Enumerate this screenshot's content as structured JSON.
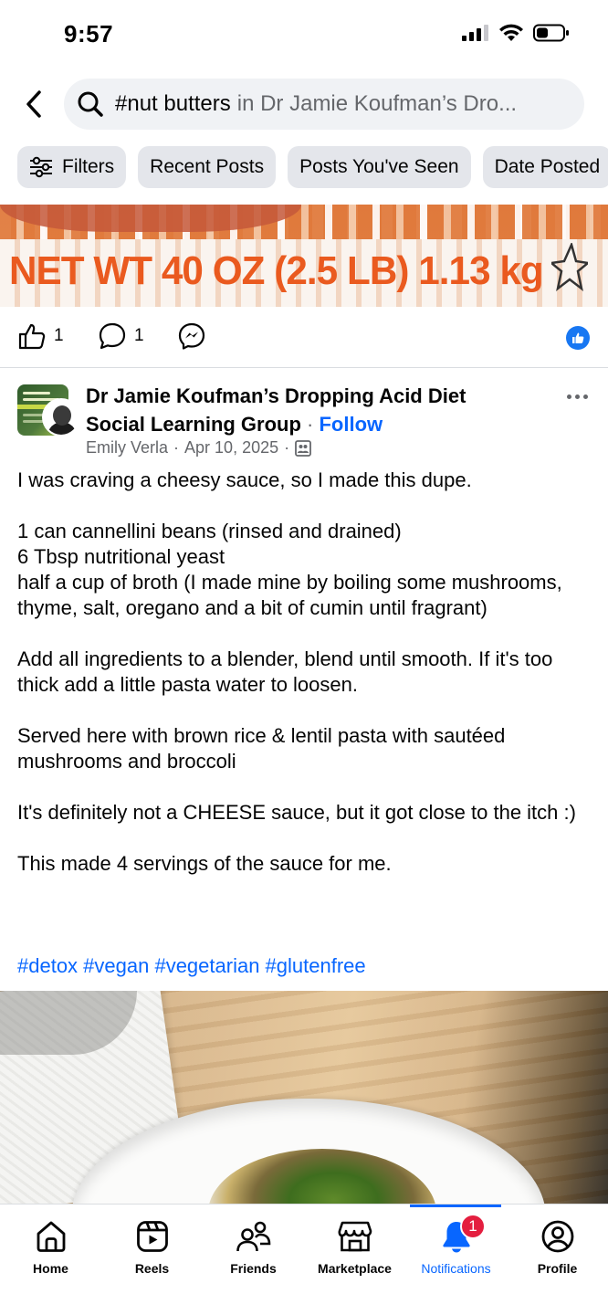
{
  "status_bar": {
    "time": "9:57"
  },
  "search": {
    "query": "#nut butters",
    "scope": "in Dr Jamie Koufman’s  Dro..."
  },
  "filters": [
    {
      "label": "Filters",
      "icon": "sliders-icon"
    },
    {
      "label": "Recent Posts"
    },
    {
      "label": "Posts You've Seen"
    },
    {
      "label": "Date Posted"
    }
  ],
  "previous_post": {
    "image_text": "NET WT 40 OZ (2.5 LB) 1.13 kg",
    "like_count": "1",
    "comment_count": "1"
  },
  "post": {
    "group_name": "Dr Jamie Koufman’s  Dropping Acid Diet Social Learning Group",
    "follow_label": "Follow",
    "author": "Emily Verla",
    "date": "Apr 10, 2025",
    "body": [
      "I was craving a cheesy sauce, so I made this dupe.",
      "",
      "1 can cannellini beans (rinsed and drained)",
      "6 Tbsp nutritional yeast",
      "half a cup of broth (I made mine by boiling some mushrooms, thyme, salt, oregano and a bit of cumin until fragrant)",
      "",
      "Add all ingredients to a blender, blend until smooth. If it's too thick add a little pasta water to loosen.",
      "",
      "Served here with brown rice & lentil pasta with sautéed mushrooms and broccoli",
      "",
      "It's definitely not a CHEESE sauce, but it got close to the itch :)",
      "",
      "This made 4 servings of the sauce for me."
    ],
    "hashtags": "#detox #vegan #vegetarian #glutenfree"
  },
  "bottom_nav": {
    "items": [
      {
        "label": "Home",
        "icon": "home-icon"
      },
      {
        "label": "Reels",
        "icon": "reels-icon"
      },
      {
        "label": "Friends",
        "icon": "friends-icon"
      },
      {
        "label": "Marketplace",
        "icon": "marketplace-icon"
      },
      {
        "label": "Notifications",
        "icon": "bell-icon",
        "badge": "1",
        "active": true
      },
      {
        "label": "Profile",
        "icon": "profile-icon"
      }
    ]
  },
  "colors": {
    "accent": "#0866ff",
    "badge": "#e41e3f",
    "secondary_text": "#65676b",
    "chip_bg": "#e4e6eb"
  }
}
